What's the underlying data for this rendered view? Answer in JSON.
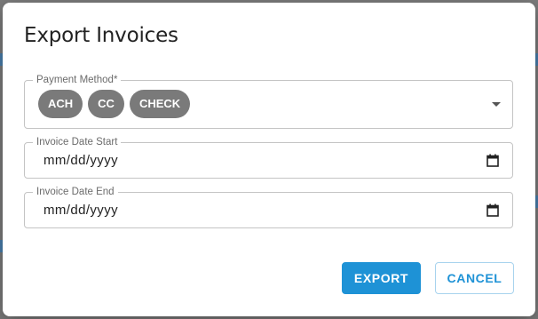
{
  "dialog": {
    "title": "Export Invoices"
  },
  "payment_method": {
    "label": "Payment Method",
    "required_marker": "*",
    "chips": [
      "ACH",
      "CC",
      "CHECK"
    ],
    "dropdown_icon": "chevron-down-icon"
  },
  "invoice_date_start": {
    "label": "Invoice Date Start",
    "value": "mm/dd/yyyy",
    "icon": "calendar-icon"
  },
  "invoice_date_end": {
    "label": "Invoice Date End",
    "value": "mm/dd/yyyy",
    "icon": "calendar-icon"
  },
  "actions": {
    "export_label": "EXPORT",
    "cancel_label": "CANCEL"
  },
  "colors": {
    "accent": "#1e92d6",
    "chip_bg": "#7a7a7a",
    "overlay": "#7c7c7c"
  }
}
